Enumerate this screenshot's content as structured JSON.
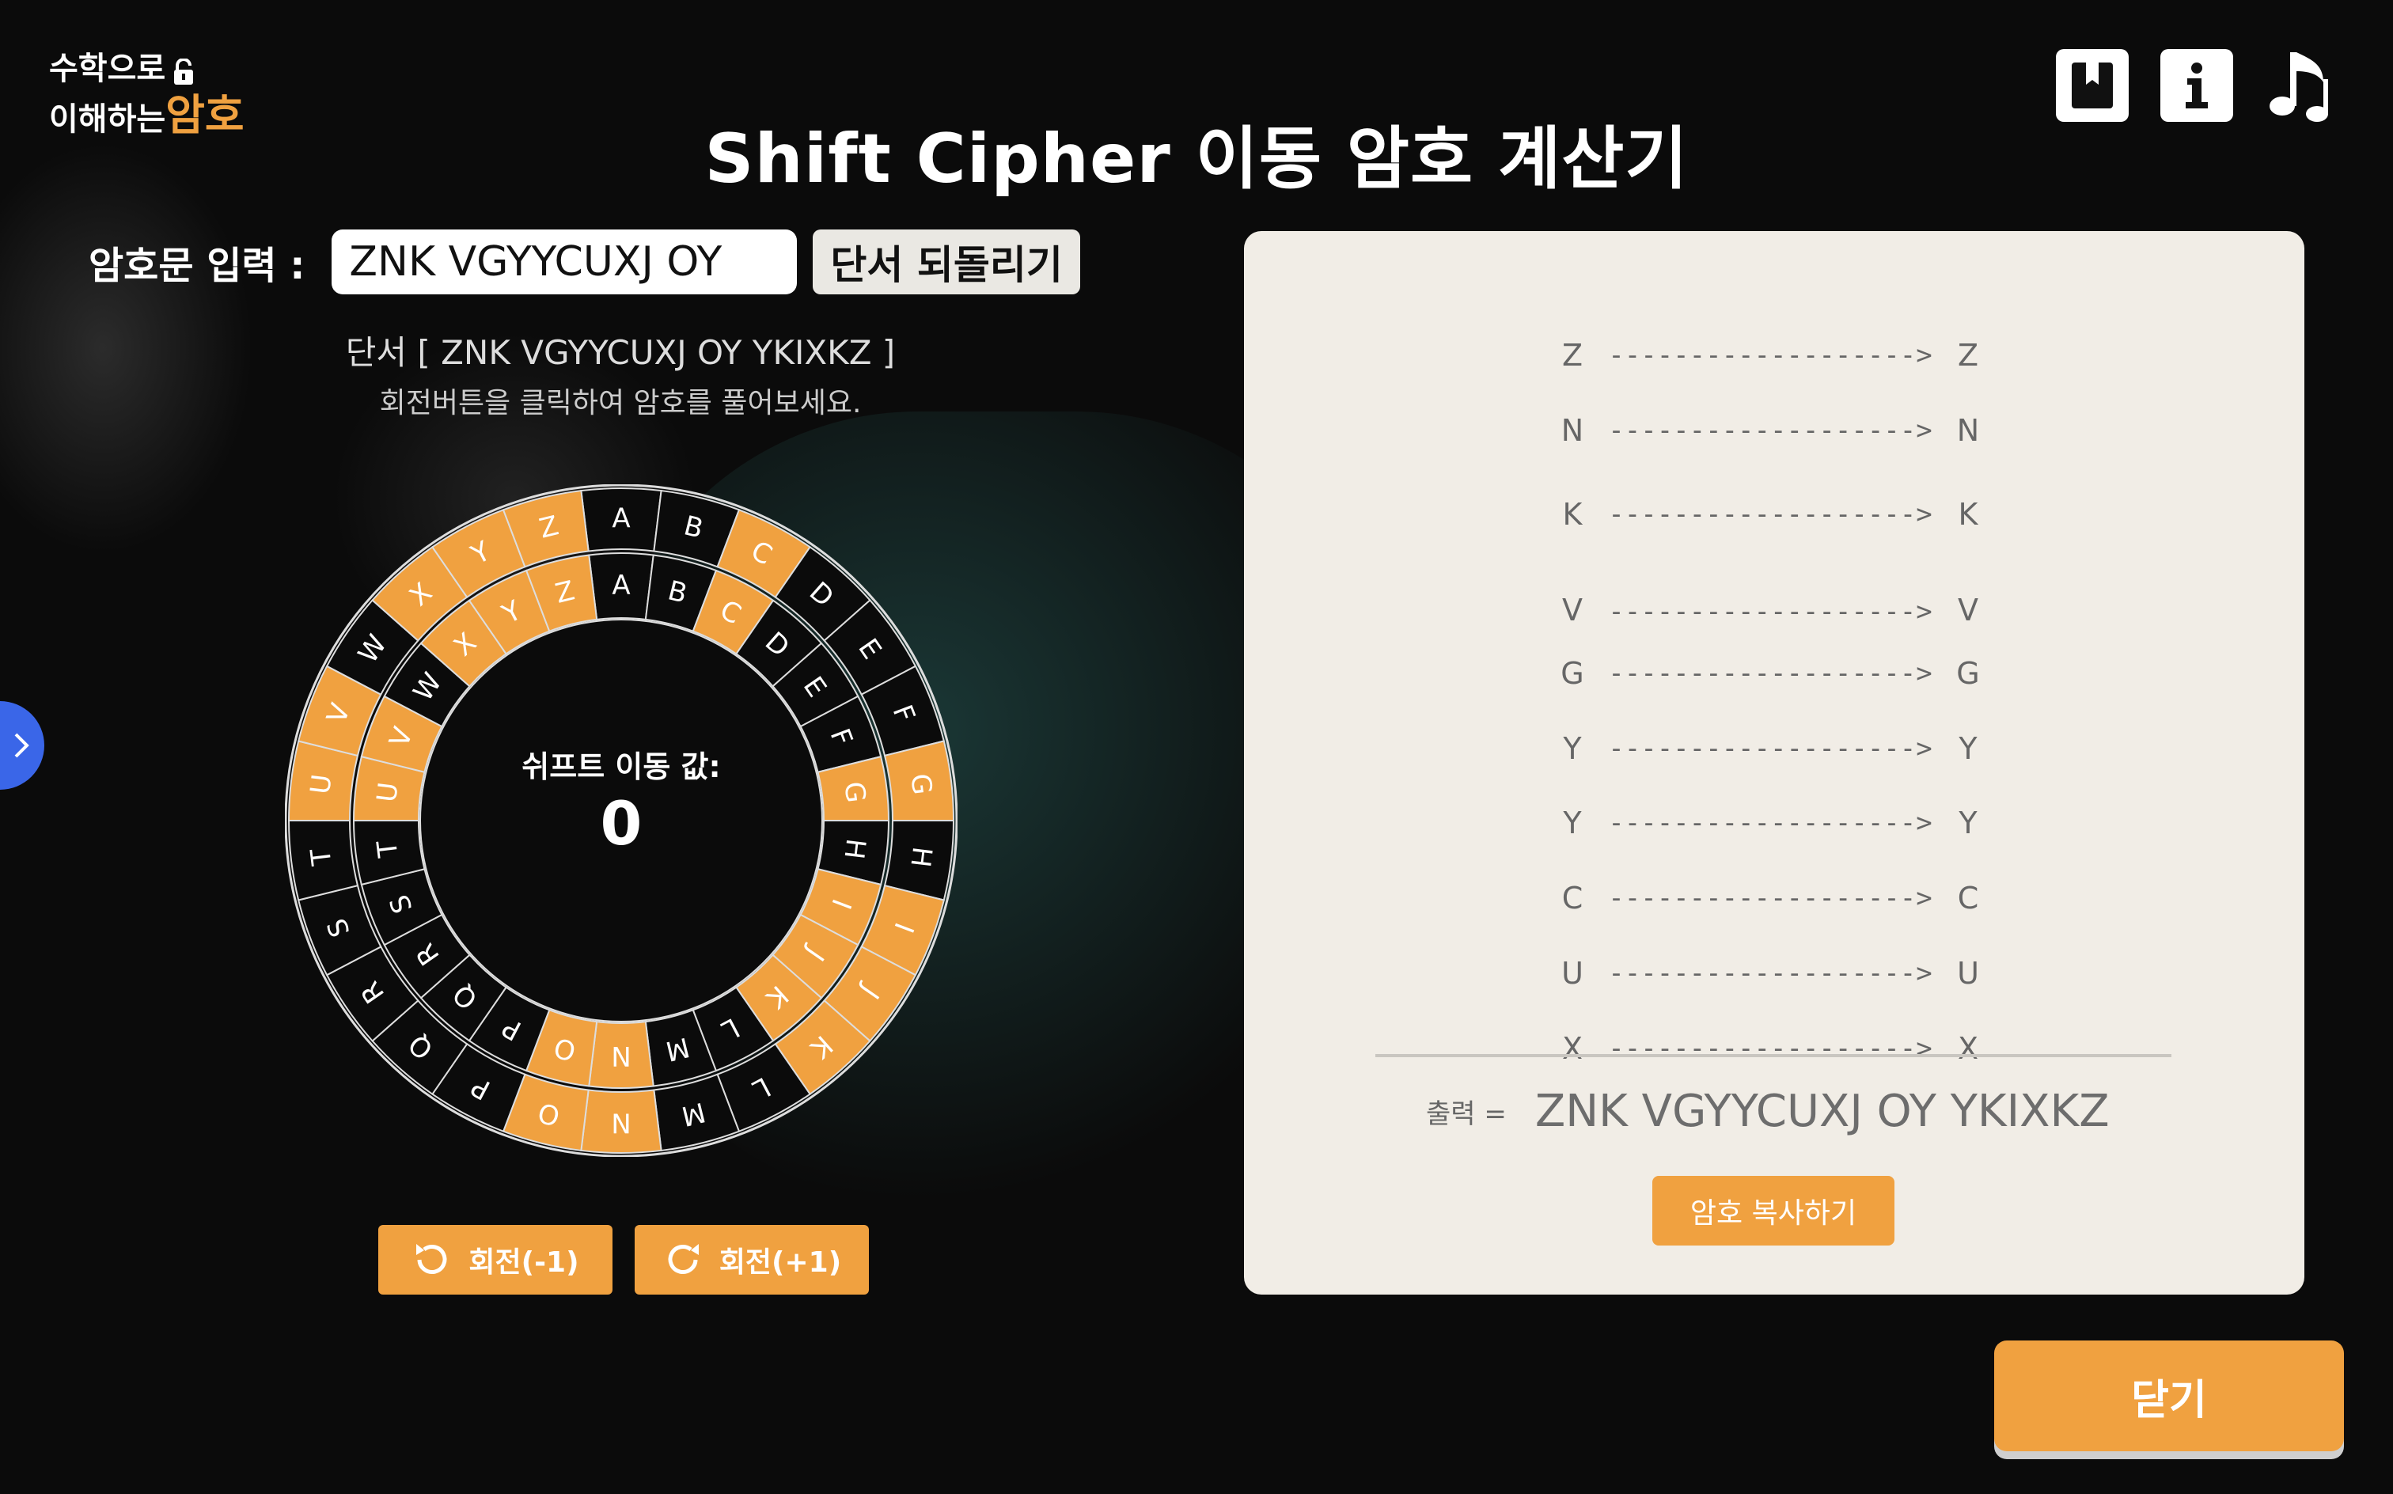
{
  "app": {
    "logo_line1": "수학으로",
    "logo_line2_prefix": "이해하는",
    "logo_line2_accent": "암호",
    "title": "Shift Cipher 이동 암호 계산기"
  },
  "top_icons": [
    "bookmark-icon",
    "info-icon",
    "music-note-icon"
  ],
  "input": {
    "label": "암호문 입력 :",
    "value": "ZNK VGYYCUXJ OY",
    "revert_label": "단서 되돌리기"
  },
  "hints": {
    "clue": "단서 [ ZNK VGYYCUXJ OY YKIXKZ ]",
    "instruction": "회전버튼을 클릭하여 암호를 풀어보세요."
  },
  "wheel": {
    "center_label": "쉬프트 이동 값:",
    "shift_value": "0",
    "letters": [
      "A",
      "B",
      "C",
      "D",
      "E",
      "F",
      "G",
      "H",
      "I",
      "J",
      "K",
      "L",
      "M",
      "N",
      "O",
      "P",
      "Q",
      "R",
      "S",
      "T",
      "U",
      "V",
      "W",
      "X",
      "Y",
      "Z"
    ],
    "orange_indices": [
      2,
      6,
      8,
      9,
      10,
      13,
      14,
      20,
      21,
      23,
      24,
      25
    ],
    "colors": {
      "orange": "#f0a140",
      "dark": "#0b0b0b",
      "line": "#dddddd"
    }
  },
  "rotate": {
    "minus_label": "회전(-1)",
    "plus_label": "회전(+1)"
  },
  "mapping": [
    {
      "from": "Z",
      "arrow": "------------------->",
      "to": "Z"
    },
    {
      "from": "N",
      "arrow": "------------------->",
      "to": "N"
    },
    {
      "from": "K",
      "arrow": "------------------->",
      "to": "K"
    },
    {
      "from": "V",
      "arrow": "------------------->",
      "to": "V"
    },
    {
      "from": "G",
      "arrow": "------------------->",
      "to": "G"
    },
    {
      "from": "Y",
      "arrow": "------------------->",
      "to": "Y"
    },
    {
      "from": "Y",
      "arrow": "------------------->",
      "to": "Y"
    },
    {
      "from": "C",
      "arrow": "------------------->",
      "to": "C"
    },
    {
      "from": "U",
      "arrow": "------------------->",
      "to": "U"
    },
    {
      "from": "X",
      "arrow": "------------------->",
      "to": "X"
    }
  ],
  "output": {
    "label": "출력 =",
    "value": "ZNK VGYYCUXJ OY YKIXKZ",
    "copy_label": "암호 복사하기"
  },
  "close_label": "닫기"
}
